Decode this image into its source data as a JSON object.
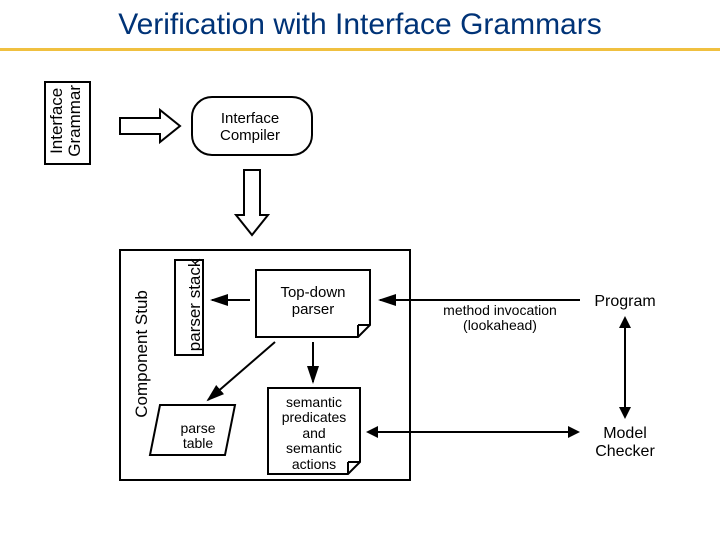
{
  "title": "Verification with Interface Grammars",
  "interface_grammar_line1": "Interface",
  "interface_grammar_line2": "Grammar",
  "interface_compiler_line1": "Interface",
  "interface_compiler_line2": "Compiler",
  "component_stub": "Component Stub",
  "parser_stack": "parser stack",
  "top_down_line1": "Top-down",
  "top_down_line2": "parser",
  "parse_table_line1": "parse",
  "parse_table_line2": "table",
  "sem_line1": "semantic",
  "sem_line2": "predicates",
  "sem_line3": "and",
  "sem_line4": "semantic",
  "sem_line5": "actions",
  "method_invocation_line1": "method invocation",
  "method_invocation_line2": "(lookahead)",
  "program": "Program",
  "model_checker_line1": "Model",
  "model_checker_line2": "Checker"
}
